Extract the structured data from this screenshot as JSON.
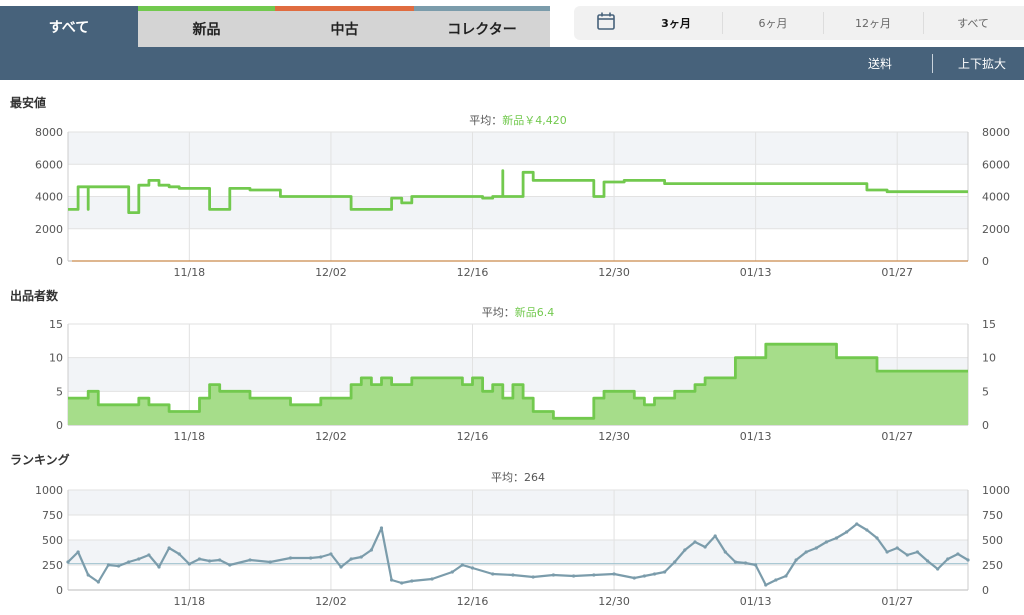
{
  "tabs": [
    {
      "label": "すべて"
    },
    {
      "label": "新品"
    },
    {
      "label": "中古"
    },
    {
      "label": "コレクター"
    }
  ],
  "ranges": [
    {
      "label": "3ヶ月"
    },
    {
      "label": "6ヶ月"
    },
    {
      "label": "12ヶ月"
    },
    {
      "label": "すべて"
    }
  ],
  "toolbar": {
    "shipping": "送料",
    "zoom": "上下拡大"
  },
  "colors": {
    "new": "#72c94e",
    "used": "#e06c40",
    "collector": "#7b9cab",
    "header": "#47627b",
    "new_fill": "#a6dd8a"
  },
  "chart_data": [
    {
      "type": "line",
      "title": "最安値",
      "subtitle_label": "平均：",
      "subtitle_value": "新品￥4,420",
      "ylim": [
        0,
        8000
      ],
      "yticks": [
        0,
        2000,
        4000,
        6000,
        8000
      ],
      "xtick_labels": [
        "11/18",
        "12/02",
        "12/16",
        "12/30",
        "01/13",
        "01/27"
      ],
      "x_range": [
        "11/06",
        "02/03"
      ],
      "series": [
        {
          "color": "#72c94e",
          "x": [
            "11/06",
            "11/07",
            "11/07",
            "11/08",
            "11/08",
            "11/09",
            "11/09",
            "11/10",
            "11/11",
            "11/12",
            "11/12",
            "11/13",
            "11/13",
            "11/13",
            "11/14",
            "11/14",
            "11/15",
            "11/16",
            "11/17",
            "11/19",
            "11/20",
            "11/21",
            "11/21",
            "11/22",
            "11/24",
            "11/25",
            "11/26",
            "11/27",
            "11/28",
            "11/30",
            "12/01",
            "12/02",
            "12/04",
            "12/05",
            "12/06",
            "12/07",
            "12/08",
            "12/09",
            "12/10",
            "12/11",
            "12/14",
            "12/15",
            "12/16",
            "12/17",
            "12/18",
            "12/19",
            "12/19",
            "12/19",
            "12/20",
            "12/21",
            "12/22",
            "12/24",
            "12/26",
            "12/28",
            "12/28",
            "12/29",
            "12/30",
            "12/31",
            "01/02",
            "01/04",
            "01/06",
            "01/08",
            "01/10",
            "01/12",
            "01/15",
            "01/18",
            "01/20",
            "01/22",
            "01/24",
            "01/26",
            "01/28",
            "01/30",
            "02/01",
            "02/03"
          ],
          "y": [
            3200,
            3200,
            4600,
            3200,
            4600,
            4600,
            4600,
            4600,
            4600,
            4600,
            3000,
            3000,
            4600,
            4700,
            4700,
            5000,
            4700,
            4600,
            4500,
            4500,
            3200,
            3200,
            3200,
            4500,
            4400,
            4400,
            4400,
            4000,
            4000,
            4000,
            4000,
            4000,
            3200,
            3200,
            3200,
            3200,
            3900,
            3600,
            4000,
            4000,
            4000,
            4000,
            4000,
            3900,
            4000,
            4000,
            5600,
            4000,
            4000,
            5500,
            5000,
            5000,
            5000,
            5000,
            4000,
            4900,
            4900,
            5000,
            5000,
            4800,
            4800,
            4800,
            4800,
            4800,
            4800,
            4800,
            4800,
            4800,
            4400,
            4300,
            4300,
            4300,
            4300,
            4300
          ]
        }
      ]
    },
    {
      "type": "area",
      "title": "出品者数",
      "subtitle_label": "平均：",
      "subtitle_value": "新品6.4",
      "ylim": [
        0,
        15
      ],
      "yticks": [
        0,
        5,
        10,
        15
      ],
      "xtick_labels": [
        "11/18",
        "12/02",
        "12/16",
        "12/30",
        "01/13",
        "01/27"
      ],
      "x_range": [
        "11/06",
        "02/03"
      ],
      "series": [
        {
          "color": "#72c94e",
          "x": [
            "11/06",
            "11/08",
            "11/08",
            "11/09",
            "11/10",
            "11/12",
            "11/13",
            "11/14",
            "11/15",
            "11/16",
            "11/16",
            "11/17",
            "11/19",
            "11/20",
            "11/21",
            "11/21",
            "11/22",
            "11/24",
            "11/27",
            "11/28",
            "12/01",
            "12/02",
            "12/03",
            "12/04",
            "12/05",
            "12/06",
            "12/07",
            "12/08",
            "12/10",
            "12/12",
            "12/13",
            "12/15",
            "12/16",
            "12/17",
            "12/18",
            "12/19",
            "12/20",
            "12/21",
            "12/22",
            "12/24",
            "12/27",
            "12/28",
            "12/29",
            "12/31",
            "01/01",
            "01/02",
            "01/03",
            "01/05",
            "01/07",
            "01/08",
            "01/09",
            "01/11",
            "01/14",
            "01/16",
            "01/21",
            "01/22",
            "01/25",
            "02/03"
          ],
          "y": [
            4,
            4,
            5,
            3,
            3,
            3,
            4,
            3,
            3,
            2,
            2,
            2,
            4,
            6,
            5,
            5,
            5,
            4,
            4,
            3,
            4,
            4,
            4,
            6,
            7,
            6,
            7,
            6,
            7,
            7,
            7,
            6,
            7,
            5,
            6,
            4,
            6,
            4,
            2,
            1,
            1,
            4,
            5,
            5,
            4,
            3,
            4,
            5,
            6,
            7,
            7,
            10,
            12,
            12,
            10,
            10,
            8,
            8
          ]
        }
      ]
    },
    {
      "type": "line",
      "title": "ランキング",
      "subtitle_label": "平均：",
      "subtitle_value": "264",
      "ylim": [
        0,
        1000
      ],
      "yticks": [
        0,
        250,
        500,
        750,
        1000
      ],
      "average": 264,
      "xtick_labels": [
        "11/18",
        "12/02",
        "12/16",
        "12/30",
        "01/13",
        "01/27"
      ],
      "x_range": [
        "11/06",
        "02/03"
      ],
      "series": [
        {
          "color": "#7b9cab",
          "x": [
            "11/06",
            "11/07",
            "11/08",
            "11/09",
            "11/10",
            "11/11",
            "11/12",
            "11/13",
            "11/14",
            "11/15",
            "11/16",
            "11/17",
            "11/18",
            "11/19",
            "11/20",
            "11/21",
            "11/22",
            "11/24",
            "11/26",
            "11/28",
            "11/30",
            "12/01",
            "12/02",
            "12/03",
            "12/04",
            "12/05",
            "12/06",
            "12/07",
            "12/08",
            "12/09",
            "12/10",
            "12/12",
            "12/14",
            "12/15",
            "12/16",
            "12/18",
            "12/20",
            "12/22",
            "12/24",
            "12/26",
            "12/28",
            "12/30",
            "01/01",
            "01/02",
            "01/03",
            "01/04",
            "01/05",
            "01/06",
            "01/07",
            "01/08",
            "01/09",
            "01/10",
            "01/11",
            "01/12",
            "01/13",
            "01/14",
            "01/15",
            "01/16",
            "01/17",
            "01/18",
            "01/19",
            "01/20",
            "01/21",
            "01/22",
            "01/23",
            "01/24",
            "01/25",
            "01/26",
            "01/27",
            "01/28",
            "01/29",
            "01/30",
            "01/31",
            "02/01",
            "02/02",
            "02/03"
          ],
          "y": [
            280,
            380,
            150,
            80,
            250,
            240,
            280,
            310,
            350,
            230,
            420,
            360,
            260,
            310,
            290,
            300,
            250,
            300,
            280,
            320,
            320,
            330,
            360,
            230,
            310,
            330,
            400,
            620,
            100,
            70,
            90,
            110,
            180,
            250,
            220,
            160,
            150,
            130,
            150,
            140,
            150,
            160,
            120,
            140,
            160,
            180,
            280,
            400,
            480,
            430,
            540,
            380,
            280,
            270,
            250,
            50,
            100,
            140,
            300,
            380,
            420,
            480,
            520,
            580,
            660,
            600,
            520,
            380,
            420,
            350,
            380,
            290,
            210,
            310,
            360,
            300
          ]
        }
      ]
    }
  ]
}
